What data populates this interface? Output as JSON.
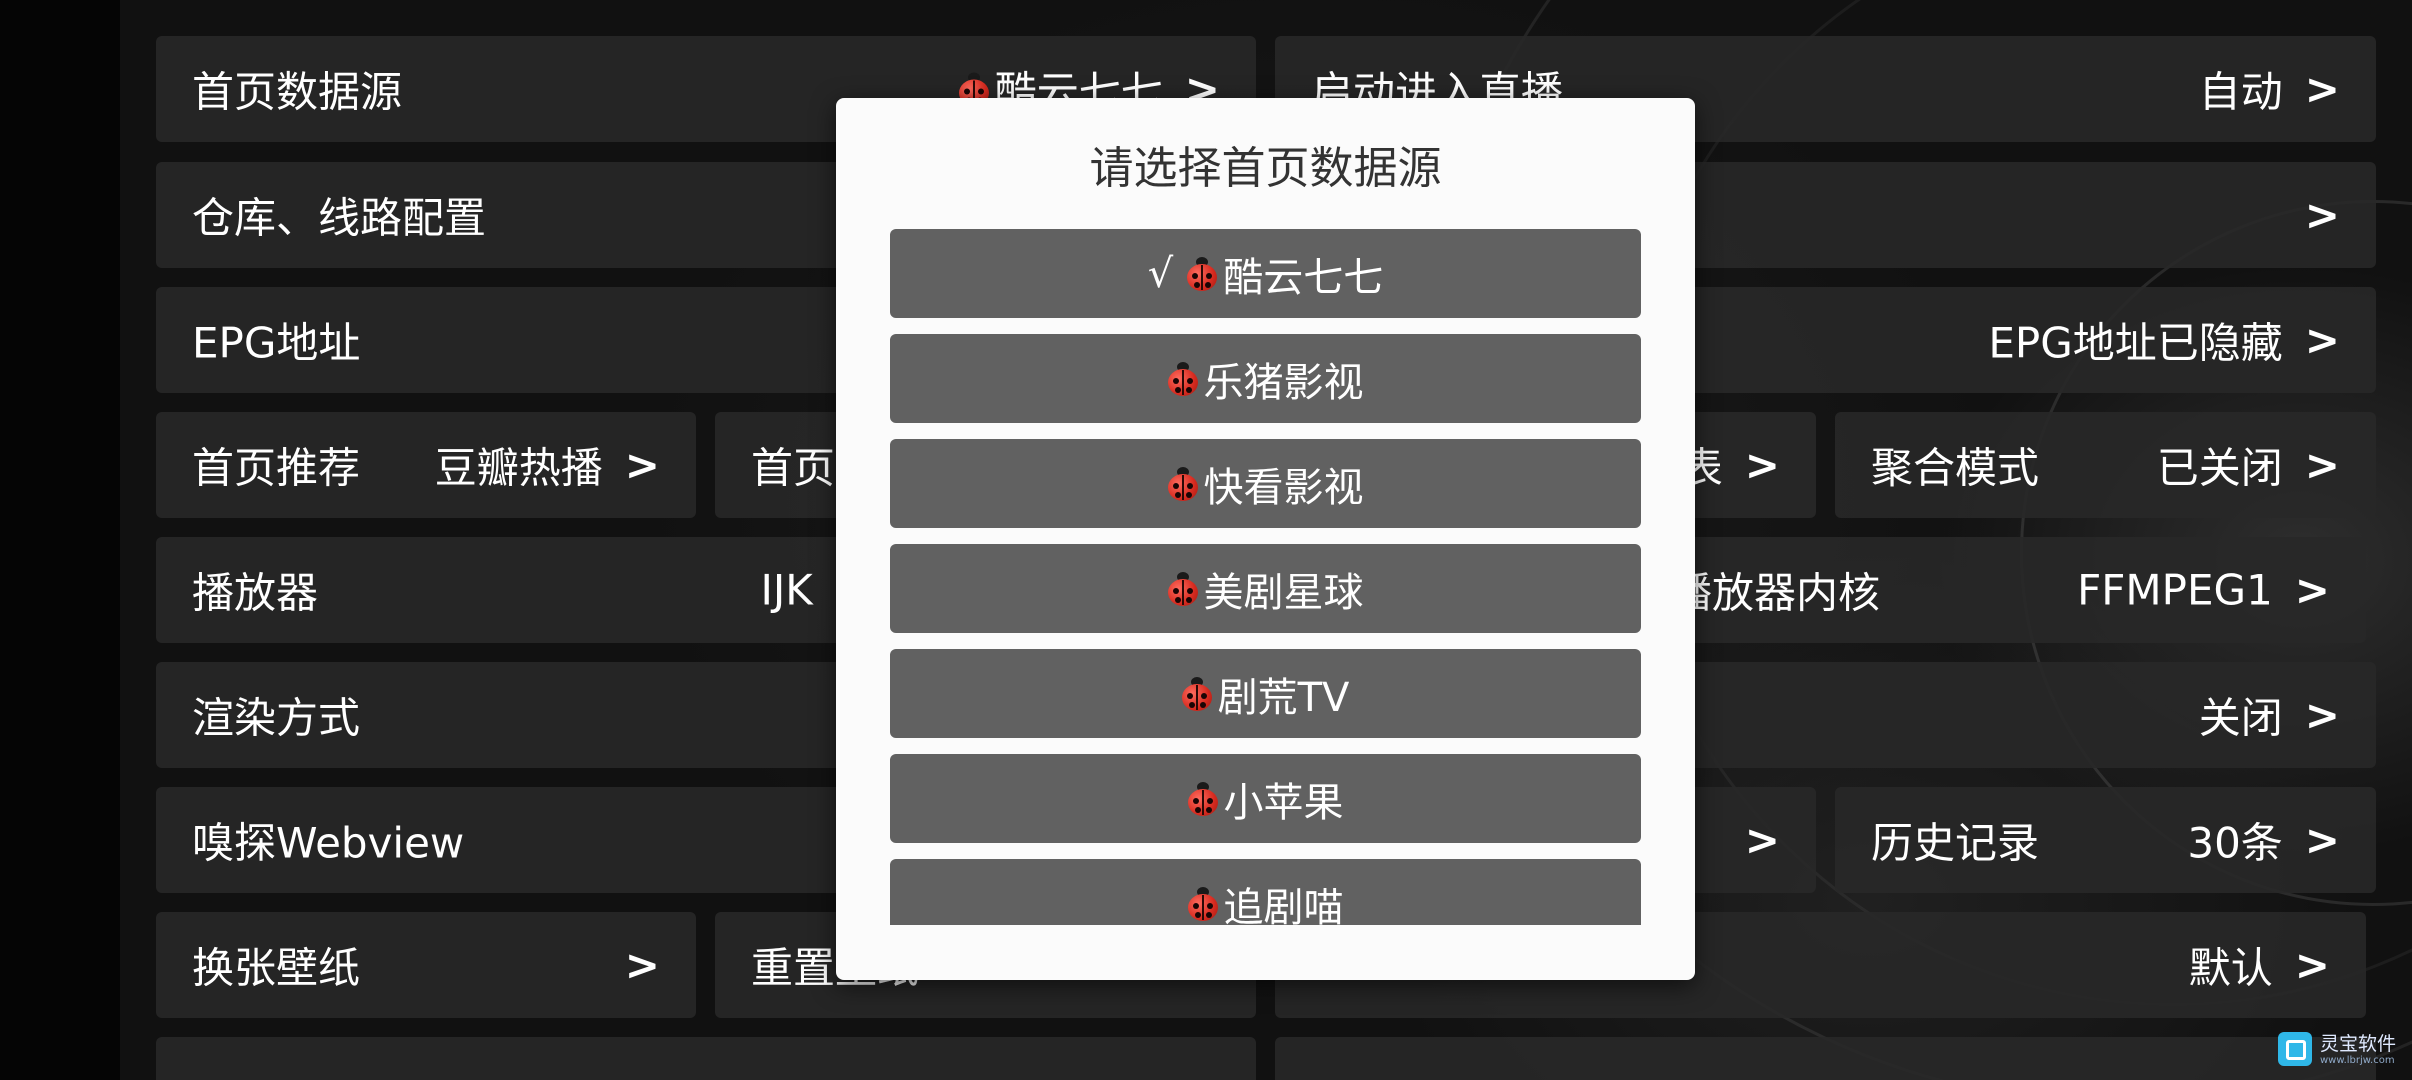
{
  "settings": {
    "home_source": {
      "label": "首页数据源",
      "value": "酷云七七",
      "arrow": ">"
    },
    "startup_live": {
      "label": "启动进入直播",
      "value": "自动",
      "arrow": ">"
    },
    "repo_config": {
      "label": "仓库、线路配置",
      "arrow": ">"
    },
    "repo_config_right": {
      "arrow": ">"
    },
    "epg": {
      "label": "EPG地址",
      "value": "EPG地址已隐藏",
      "arrow": ">"
    },
    "home_recommend": {
      "label": "首页推荐",
      "value": "豆瓣热播",
      "arrow": ">"
    },
    "home_partial": {
      "label": "首页"
    },
    "list_partial": {
      "value": "表",
      "arrow": ">"
    },
    "aggregate_mode": {
      "label": "聚合模式",
      "value": "已关闭",
      "arrow": ">"
    },
    "player": {
      "label": "播放器",
      "value": "IJK",
      "arrow": ">"
    },
    "player_core": {
      "label": "播放器内核",
      "value": "FFMPEG1",
      "arrow": ">"
    },
    "render": {
      "label": "渲染方式"
    },
    "render_right": {
      "value": "关闭",
      "arrow": ">"
    },
    "sniff": {
      "label": "嗅探Webview"
    },
    "sniff_right": {
      "arrow": ">"
    },
    "history": {
      "label": "历史记录",
      "value": "30条",
      "arrow": ">"
    },
    "wallpaper": {
      "label": "换张壁纸",
      "arrow": ">"
    },
    "reset_partial": {
      "label": "重置壁纸"
    },
    "default_row": {
      "value": "默认",
      "arrow": ">"
    }
  },
  "dialog": {
    "title": "请选择首页数据源",
    "check_mark": "√",
    "options": [
      {
        "label": "酷云七七",
        "selected": true
      },
      {
        "label": "乐猪影视",
        "selected": false
      },
      {
        "label": "快看影视",
        "selected": false
      },
      {
        "label": "美剧星球",
        "selected": false
      },
      {
        "label": "剧荒TV",
        "selected": false
      },
      {
        "label": "小苹果",
        "selected": false
      },
      {
        "label": "追剧喵",
        "selected": false
      }
    ]
  },
  "watermark": {
    "name": "灵宝软件",
    "url": "www.lbrjw.com"
  },
  "icons": {
    "option_icon": "ladybug-icon",
    "source_icon": "ladybug-icon"
  },
  "colors": {
    "row_bg": "#282828",
    "modal_bg": "#fbfbfb",
    "option_bg": "#616161",
    "text": "#ffffff"
  }
}
